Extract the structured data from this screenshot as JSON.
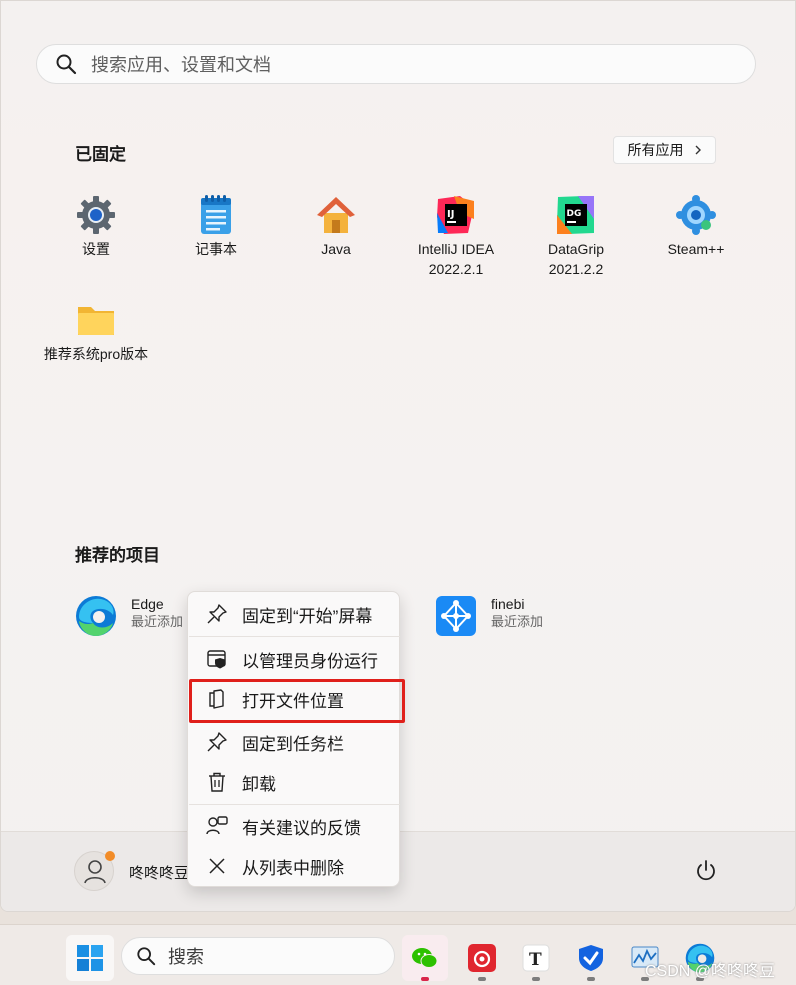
{
  "search": {
    "placeholder": "搜索应用、设置和文档"
  },
  "pinned": {
    "title": "已固定",
    "all_apps_label": "所有应用",
    "apps": [
      {
        "label": "设置",
        "icon": "settings-gear-icon"
      },
      {
        "label": "记事本",
        "icon": "notepad-icon"
      },
      {
        "label": "Java",
        "icon": "java-house-icon"
      },
      {
        "label": "IntelliJ IDEA\n2022.2.1",
        "icon": "intellij-idea-icon"
      },
      {
        "label": "DataGrip\n2021.2.2",
        "icon": "datagrip-icon"
      },
      {
        "label": "Steam++",
        "icon": "steampp-icon"
      },
      {
        "label": "推荐系统pro版本",
        "icon": "folder-icon"
      }
    ]
  },
  "recommended": {
    "title": "推荐的项目",
    "items": [
      {
        "name": "Edge",
        "sub": "最近添加",
        "icon": "edge-icon"
      },
      {
        "name": "finebi",
        "sub": "最近添加",
        "icon": "finebi-icon"
      }
    ]
  },
  "context_menu": {
    "items": [
      {
        "label": "固定到“开始”屏幕",
        "icon": "pin-icon"
      },
      {
        "label": "以管理员身份运行",
        "icon": "run-as-admin-icon"
      },
      {
        "label": "打开文件位置",
        "icon": "open-file-location-icon"
      },
      {
        "label": "固定到任务栏",
        "icon": "pin-icon"
      },
      {
        "label": "卸载",
        "icon": "trash-icon"
      },
      {
        "label": "有关建议的反馈",
        "icon": "feedback-icon"
      },
      {
        "label": "从列表中删除",
        "icon": "close-icon"
      }
    ]
  },
  "footer": {
    "user_name": "咚咚咚豆"
  },
  "taskbar": {
    "search_label": "搜索",
    "apps": [
      "wechat-icon",
      "netease-music-icon",
      "typora-icon",
      "security-shield-icon",
      "resource-monitor-icon",
      "edge-icon"
    ]
  },
  "watermark": "CSDN @咚咚咚豆"
}
